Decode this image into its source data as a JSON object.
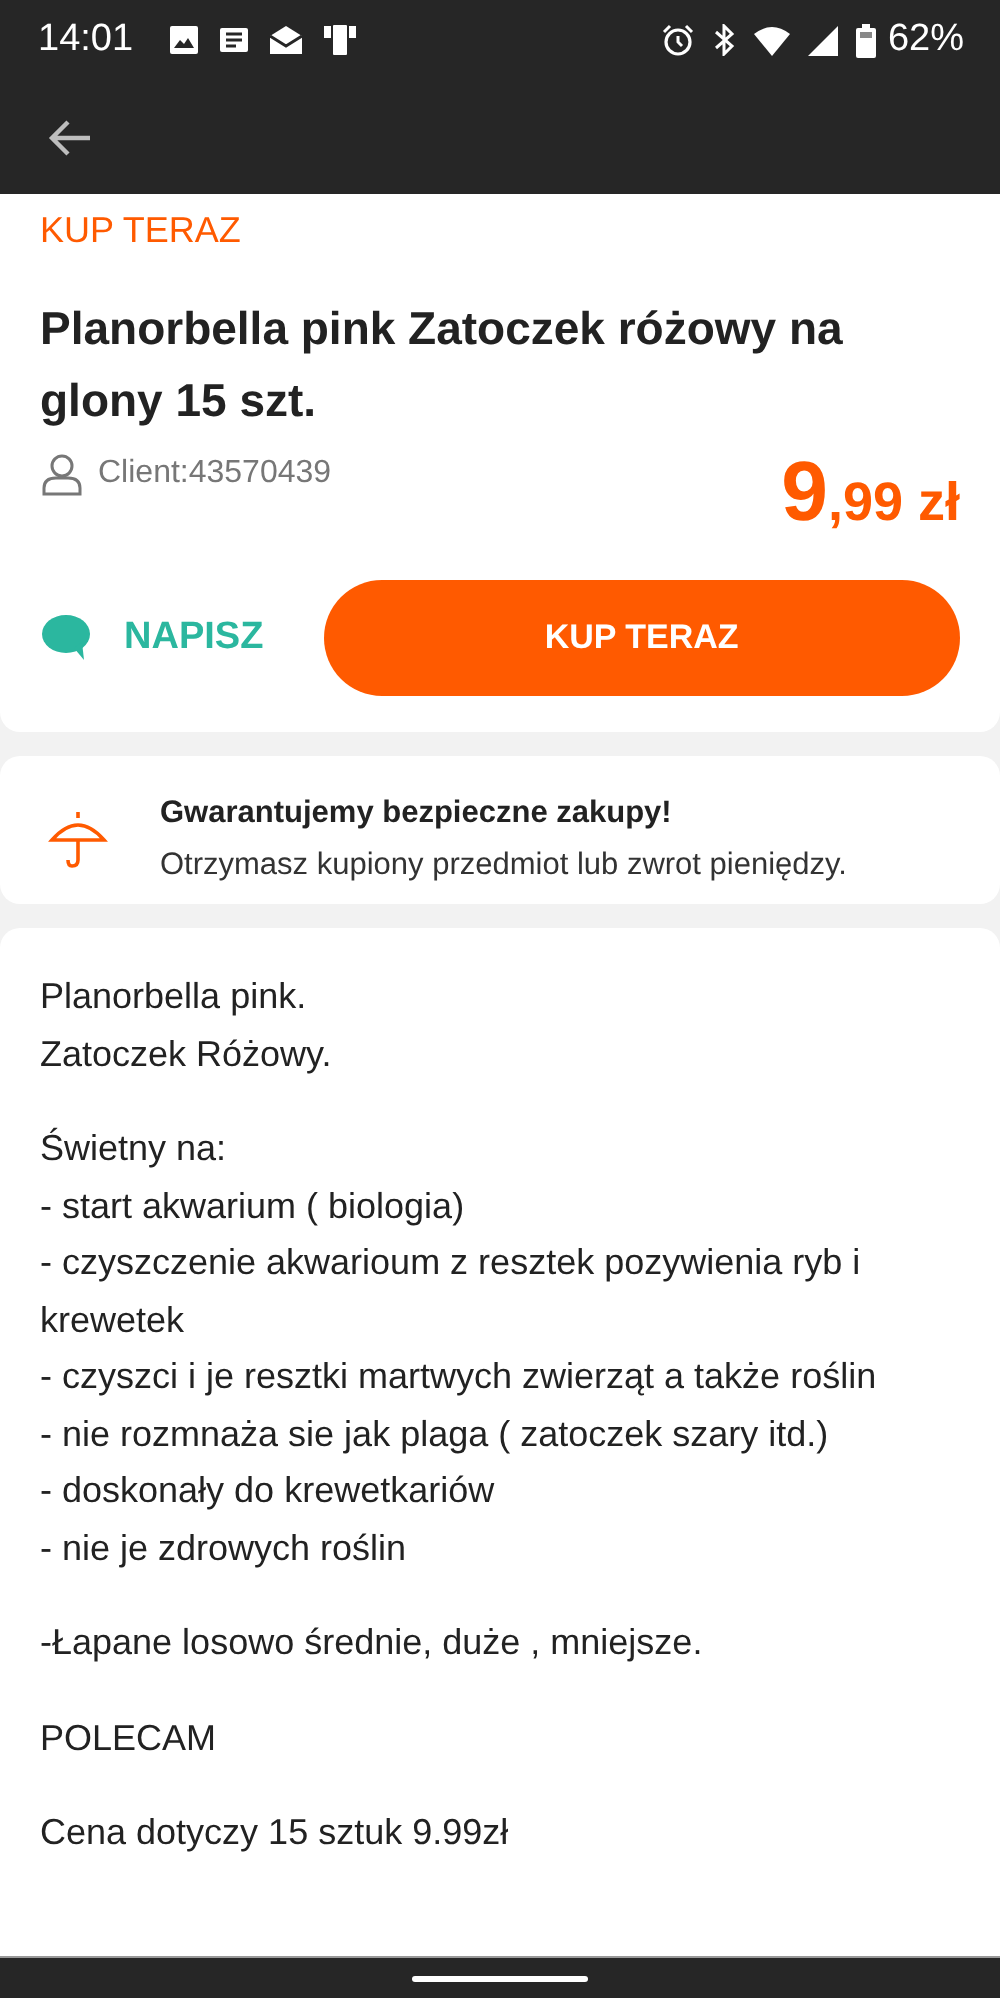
{
  "status_bar": {
    "time": "14:01",
    "battery": "62%"
  },
  "offer": {
    "section_label": "KUP TERAZ",
    "title": "Planorbella pink Zatoczek różowy na glony 15 szt.",
    "seller": "Client:43570439",
    "price_main": "9",
    "price_rest": ",99 zł",
    "message_button": "NAPISZ",
    "buy_button": "KUP TERAZ"
  },
  "guarantee": {
    "title": "Gwarantujemy bezpieczne zakupy!",
    "text": "Otrzymasz kupiony przedmiot lub zwrot pieniędzy."
  },
  "description": [
    [
      "Planorbella pink.",
      "Zatoczek Różowy."
    ],
    [
      "Świetny na:",
      "- start akwarium ( biologia)",
      "- czyszczenie akwarioum z resztek pozywienia ryb i krewetek",
      "- czyszci i je resztki martwych zwierząt a także roślin",
      "- nie rozmnaża sie jak plaga ( zatoczek szary itd.)",
      "- doskonały do krewetkariów",
      "- nie je zdrowych roślin"
    ],
    [
      "-Łapane losowo średnie, duże , mniejsze."
    ],
    [
      "POLECAM"
    ],
    [
      "Cena dotyczy 15 sztuk 9.99zł"
    ]
  ]
}
